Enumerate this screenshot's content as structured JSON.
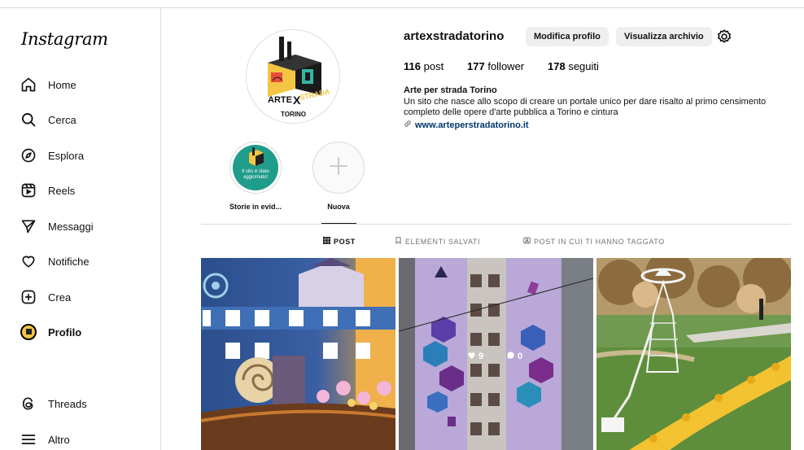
{
  "app": {
    "logo": "Instagram"
  },
  "sidebar": {
    "items": [
      {
        "label": "Home",
        "icon": "home-icon"
      },
      {
        "label": "Cerca",
        "icon": "search-icon"
      },
      {
        "label": "Esplora",
        "icon": "compass-icon"
      },
      {
        "label": "Reels",
        "icon": "reels-icon"
      },
      {
        "label": "Messaggi",
        "icon": "send-icon"
      },
      {
        "label": "Notifiche",
        "icon": "heart-icon"
      },
      {
        "label": "Crea",
        "icon": "plus-square-icon"
      },
      {
        "label": "Profilo",
        "icon": "avatar-icon"
      }
    ],
    "bottom": [
      {
        "label": "Threads",
        "icon": "threads-icon"
      },
      {
        "label": "Altro",
        "icon": "menu-icon"
      }
    ]
  },
  "profile": {
    "username": "artexstradatorino",
    "edit_button": "Modifica profilo",
    "archive_button": "Visualizza archivio",
    "stats": {
      "posts_count": "116",
      "posts_label": "post",
      "followers_count": "177",
      "followers_label": "follower",
      "following_count": "178",
      "following_label": "seguiti"
    },
    "bio_name": "Arte per strada Torino",
    "bio_text": "Un sito che nasce allo scopo di creare un portale unico per dare risalto al primo censimento completo delle opere d'arte pubblica a Torino e cintura",
    "bio_link": "www.arteperstradatorino.it",
    "avatar_text": {
      "line1": "ARTE",
      "line2": "X",
      "line3": "STRADA",
      "line4": "TORINO"
    }
  },
  "highlights": [
    {
      "label": "Storie in evid...",
      "inner_text": "Il sito è stato aggiornato!"
    },
    {
      "label": "Nuova"
    }
  ],
  "tabs": [
    {
      "label": "POST",
      "active": true,
      "icon": "grid-icon"
    },
    {
      "label": "ELEMENTI SALVATI",
      "active": false,
      "icon": "bookmark-icon"
    },
    {
      "label": "POST IN CUI TI HANNO TAGGATO",
      "active": false,
      "icon": "tag-icon"
    }
  ],
  "post_overlay": {
    "likes": "9",
    "comments": "0"
  },
  "colors": {
    "link": "#00376b",
    "button_bg": "#efefef",
    "border": "#dbdbdb",
    "muted": "#737373"
  }
}
